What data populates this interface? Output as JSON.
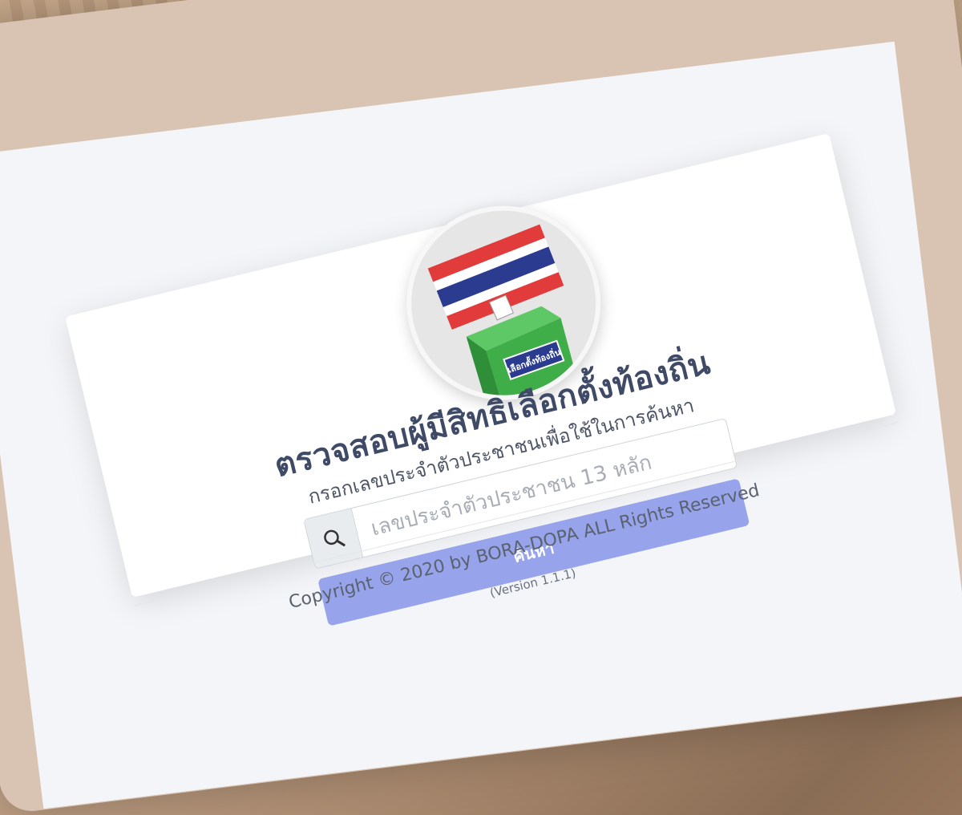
{
  "logo": {
    "label": "เลือกตั้งท้องถิ่น"
  },
  "header": {
    "title": "ตรวจสอบผู้มีสิทธิเลือกตั้งท้องถิ่น",
    "subtitle": "กรอกเลขประจำตัวประชาชนเพื่อใช้ในการค้นหา"
  },
  "search": {
    "placeholder": "เลขประจำตัวประชาชน 13 หลัก",
    "value": "",
    "button_label": "ค้นหา",
    "icon": "search-icon"
  },
  "footer": {
    "copyright": "Copyright © 2020 by BORA-DOPA ALL Rights Reserved",
    "version": "(Version 1.1.1)"
  },
  "colors": {
    "button": "#97a3ea",
    "title": "#3f4a66",
    "ballot_box": "#3fae49",
    "flag_red": "#e23b3b",
    "flag_blue": "#2b3b8f"
  }
}
